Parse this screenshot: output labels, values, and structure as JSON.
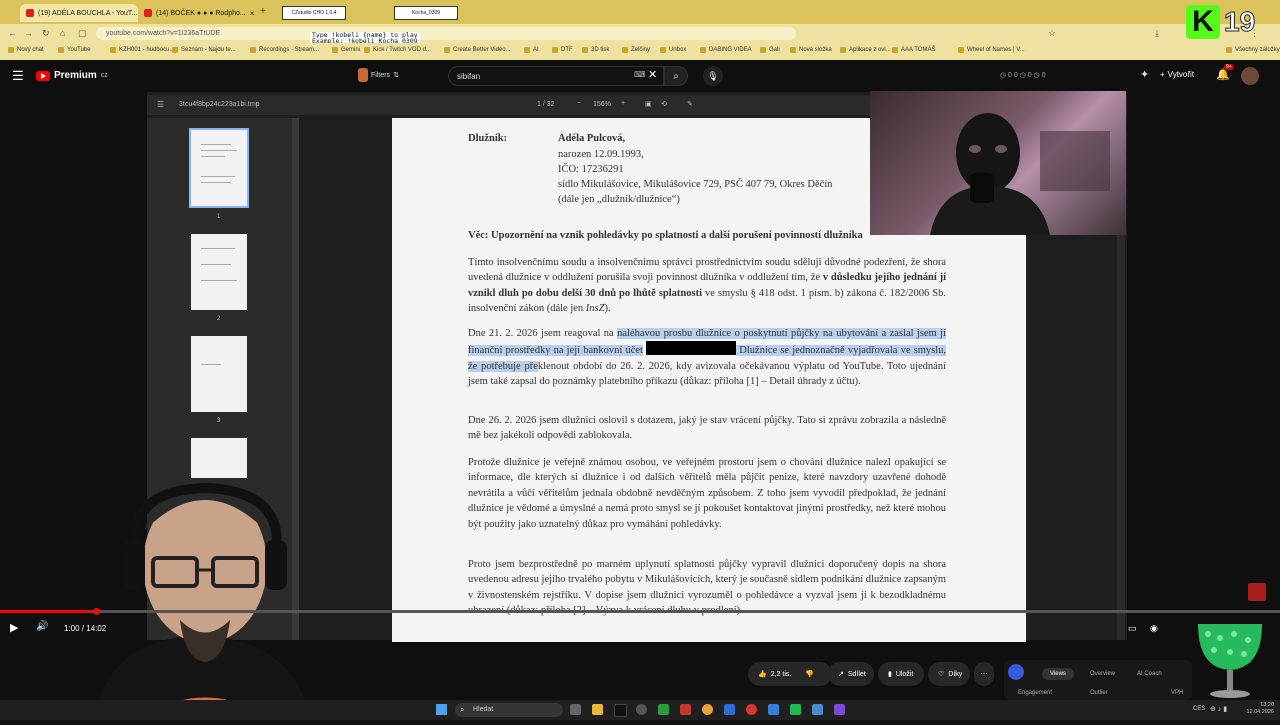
{
  "browser": {
    "tabs": [
      {
        "label": "(19) ADÉLA BOUCHLA - YouT..."
      },
      {
        "label": "(14) BOČEK ● ● ● Rodpho..."
      },
      {
        "label": "CZstudio CHO 1.0.4"
      },
      {
        "label": "Kocha_0309"
      }
    ],
    "url": "youtube.com/watch?v=1I236aTtUDE",
    "bookmarks": [
      "Nový chat",
      "YouTube",
      "KZH001 - hudbocu...",
      "Seznam - Najdu te...",
      "Recordings - Stream...",
      "Gemini",
      "Kick / Twitch VOD d...",
      "Create Better Video...",
      "AI",
      "DTF",
      "3D tisk",
      "Zelčiny",
      "Unbox",
      "DABING VIDEA",
      "Gali",
      "Nová složka",
      "Aplikace z ovl...",
      "AAA TOMÁŠ",
      "Wheel of Names | V...",
      "Všechny záložky"
    ]
  },
  "overlay_text": {
    "line1": "Type !kobeli {name} to play",
    "line2": "Example: !kobeli Kocha_0309"
  },
  "badge": {
    "letter": "K",
    "number": "19"
  },
  "youtube": {
    "premium_label": "Premium",
    "premium_sup": "CZ",
    "search_value": "sibifan",
    "filters_label": "Filters",
    "create_label": "Vytvořit",
    "notif_count": "9+"
  },
  "pdf": {
    "filename": "3tcu4f8bp24c223a1bi.tmp",
    "page_indicator": "1 / 32",
    "zoom": "156%",
    "thumb_numbers": [
      "1",
      "2",
      "3"
    ],
    "debtor_label": "Dlužník:",
    "debtor_name": "Adéla Pulcová,",
    "debtor_born": "narozen 12.09.1993,",
    "debtor_ico": "IČO: 17236291",
    "debtor_seat": "sídlo Mikulášovice, Mikulášovice 729, PSČ 407 79, Okres Děčín",
    "debtor_alias": "(dále jen „dlužník/dlužnice“)",
    "subject": "Věc: Upozornění na vznik pohledávky po splatnosti a další porušení povinností dlužníka",
    "para1_a": "Tímto insolvenčnímu soudu a insolvenčnímu správci prostřednictvím soudu sděluji důvodné podezření, že shora uvedená dlužnice v oddlužení porušila svoji povinnost dlužníka v oddlužení tím, že ",
    "para1_b": "v důsledku jejího jednání jí vznikl dluh po dobu delší 30 dnů po lhůtě splatnosti",
    "para1_c": " ve smyslu § 418 odst. 1 písm. b) zákona č. 182/2006 Sb. insolvenční zákon (dále jen ",
    "para1_d": "InsZ",
    "para1_e": ").",
    "para2_a": "Dne 21. 2. 2026 jsem reagoval na ",
    "para2_hl1": "naléhavou prosbu dlužnice o poskytnutí půjčky na ubytování a zaslal jsem jí finanční prostředky na její bankovní účet",
    "para2_hl2": " Dlužnice se jednoznačně vyjadřovala ve smyslu, že potřebuje pře",
    "para2_b": "klenout období do 26. 2. 2026, kdy avizovala očekávanou výplatu od YouTube. Toto ujednání jsem také zapsal do poznámky platebního příkazu (důkaz: příloha [1] – Detail úhrady z účtu).",
    "para3": "Dne 26. 2. 2026 jsem dlužnici oslovil s dotazem, jaký je stav vrácení půjčky. Tato si zprávu zobrazila a následně mě bez jakékoli odpovědi zablokovala.",
    "para4": "Protože dlužnice je veřejně známou osobou, ve veřejném prostoru jsem o chování dlužnice nalezl opakující se informace, dle kterých si dlužnice i od dalších věřitelů měla půjčit peníze, které navzdory uzavřené dohodě nevrátila a vůči věřitelům jednala obdobně nevděčným způsobem. Z toho jsem vyvodil předpoklad, že jednání dlužnice je vědomé a úmyslné a nemá proto smysl se jí pokoušet kontaktovat jinými prostředky, než které mohou být použity jako uznatelný důkaz pro vymáhání pohledávky.",
    "para5": "Proto jsem bezprostředně po marném uplynutí splatnosti půjčky vypravil dlužnici doporučený dopis na shora uvedenou adresu jejího trvalého pobytu v Mikulášovicích, který je současně sídlem podnikání dlužnice zapsaným v živnostenském rejstříku. V dopise jsem dlužnici vyrozuměl o pohledávce a vyzval jsem ji k bezodkladnému uhrazení (důkaz: příloha [2] – Výzva k vrácení dluhu v prodlení)."
  },
  "player": {
    "time": "1:00 / 14:02",
    "progress_fraction": 0.071
  },
  "actions": {
    "likes": "2,2 tis.",
    "share": "Sdílet",
    "save": "Uložit",
    "thanks": "Díky"
  },
  "analytics": {
    "tabs": [
      "Views",
      "Overview",
      "AI Coach"
    ],
    "sub": [
      "Engagement",
      "Outlier",
      "VPH"
    ]
  },
  "taskbar": {
    "search_placeholder": "Hledat",
    "lang": "CES",
    "time": "13:20",
    "date": "12.04.2026"
  }
}
